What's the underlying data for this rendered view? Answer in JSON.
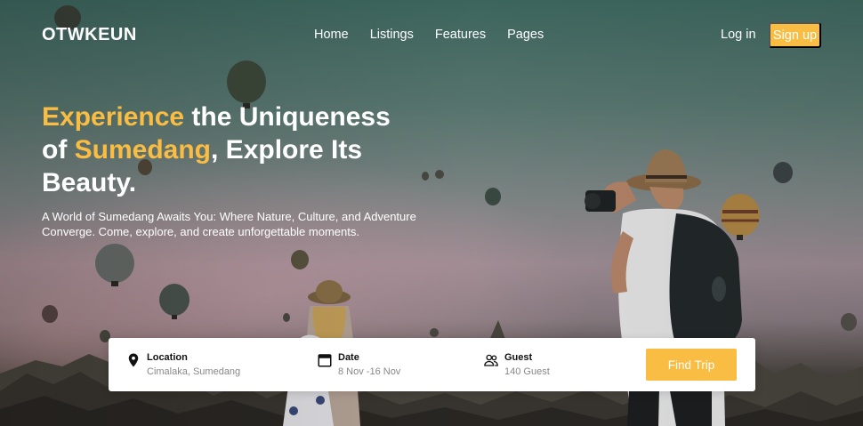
{
  "brand": {
    "logo": "OTWKEUN"
  },
  "nav": {
    "links": [
      "Home",
      "Listings",
      "Features",
      "Pages"
    ],
    "login": "Log in",
    "signup": "Sign up"
  },
  "hero": {
    "headline": {
      "w1": "Experience",
      "w2": " the Uniqueness",
      "w3": "of ",
      "w4": "Sumedang",
      "w5": ", Explore Its",
      "w6": "Beauty."
    },
    "subtext": "A World of Sumedang Awaits You: Where Nature, Culture, and Adventure Converge. Come, explore, and create unforgettable moments."
  },
  "search": {
    "location": {
      "title": "Location",
      "value": "Cimalaka, Sumedang",
      "icon": "map-pin-icon"
    },
    "date": {
      "title": "Date",
      "value": "8 Nov -16 Nov",
      "icon": "calendar-icon"
    },
    "guest": {
      "title": "Guest",
      "value": "140 Guest",
      "icon": "users-icon"
    },
    "button": "Find Trip"
  },
  "colors": {
    "accent": "#f8bd42",
    "text_light": "#ffffff",
    "muted": "#888888"
  }
}
